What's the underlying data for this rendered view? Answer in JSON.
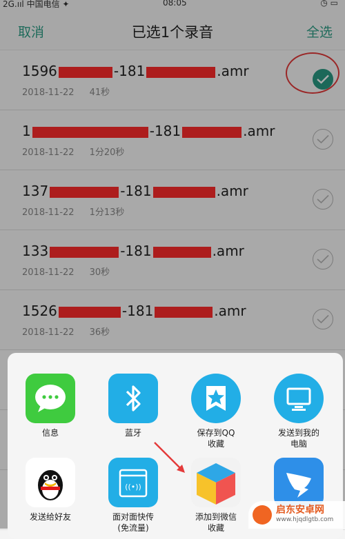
{
  "statusbar": {
    "carrier": "2G.ııl 中国电信 ✦",
    "time": "08:05",
    "right": "◷ ▭"
  },
  "nav": {
    "left": "取消",
    "title": "已选1个录音",
    "right": "全选"
  },
  "recordings": [
    {
      "name_a": "1596",
      "name_b": "-181",
      "name_c": ".amr",
      "date": "2018-11-22",
      "duration": "41秒",
      "selected": true
    },
    {
      "name_a": "1",
      "name_b": "-181",
      "name_c": ".amr",
      "date": "2018-11-22",
      "duration": "1分20秒",
      "selected": false
    },
    {
      "name_a": "137",
      "name_b": "-181",
      "name_c": ".amr",
      "date": "2018-11-22",
      "duration": "1分13秒",
      "selected": false
    },
    {
      "name_a": "133",
      "name_b": "-181",
      "name_c": ".amr",
      "date": "2018-11-22",
      "duration": "30秒",
      "selected": false
    },
    {
      "name_a": "1526",
      "name_b": "-181",
      "name_c": ".amr",
      "date": "2018-11-22",
      "duration": "36秒",
      "selected": false
    }
  ],
  "share": {
    "row1": [
      "信息",
      "蓝牙",
      "保存到QQ\n收藏",
      "发送到我的\n电脑"
    ],
    "row2": [
      "发送给好友",
      "面对面快传\n(免流量)",
      "添加到微信\n收藏",
      ""
    ]
  },
  "watermark": {
    "title": "启东安卓网",
    "url": "www.hjqdlgtb.com"
  },
  "colors": {
    "accent": "#2e9e86",
    "check_selected": "#2a9a83",
    "redaction": "#ff2b2b",
    "annotation": "#e43a3a"
  }
}
